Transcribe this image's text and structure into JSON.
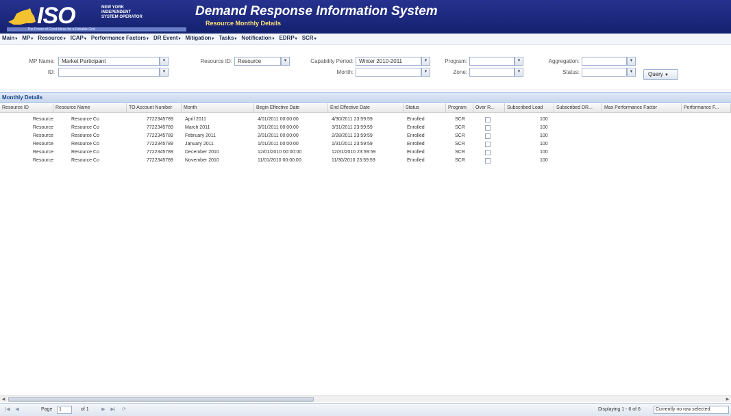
{
  "header": {
    "logo_text": "ISO",
    "logo_org": "NEW YORK INDEPENDENT SYSTEM OPERATOR",
    "logo_tagline": "The Power of Good Ideas for a Reliable Grid",
    "title": "Demand Response Information System",
    "subtitle": "Resource Monthly Details",
    "bar_color": "#1b2a7e",
    "subtitle_color": "#ffe27a"
  },
  "menu": [
    {
      "label": "Main",
      "icon": "chevron-down-icon"
    },
    {
      "label": "MP",
      "icon": "chevron-down-icon"
    },
    {
      "label": "Resource",
      "icon": "chevron-down-icon"
    },
    {
      "label": "ICAP",
      "icon": "chevron-down-icon"
    },
    {
      "label": "Performance Factors",
      "icon": "chevron-down-icon"
    },
    {
      "label": "DR Event",
      "icon": "chevron-down-icon"
    },
    {
      "label": "Mitigation",
      "icon": "chevron-down-icon"
    },
    {
      "label": "Tasks",
      "icon": "chevron-down-icon"
    },
    {
      "label": "Notification",
      "icon": "chevron-down-icon"
    },
    {
      "label": "EDRP",
      "icon": "chevron-down-icon"
    },
    {
      "label": "SCR",
      "icon": "chevron-down-icon"
    }
  ],
  "filters": {
    "mp_name": {
      "label": "MP Name:",
      "value": "Market Participant"
    },
    "id": {
      "label": "ID:",
      "value": ""
    },
    "resource_id": {
      "label": "Resource ID:",
      "value": "Resource"
    },
    "capability_period": {
      "label": "Capability Period:",
      "value": "Winter 2010-2011"
    },
    "month": {
      "label": "Month:",
      "value": ""
    },
    "program": {
      "label": "Program:",
      "value": ""
    },
    "zone": {
      "label": "Zone:",
      "value": ""
    },
    "aggregation": {
      "label": "Aggregation:",
      "value": ""
    },
    "status": {
      "label": "Status:",
      "value": ""
    },
    "query_label": "Query"
  },
  "grid": {
    "title": "Monthly Details",
    "columns": [
      "Resource ID",
      "Resource Name",
      "TO Account Number",
      "Month",
      "Begin Effective Date",
      "End Effective Date",
      "Status",
      "Program",
      "Over R...",
      "Subscribed Load",
      "Subscribed DR...",
      "Max Performance Factor",
      "Performance F..."
    ],
    "rows": [
      [
        "Resource",
        "Resource Co",
        "7722345789",
        "April 2011",
        "4/01/2011 00:00:00",
        "4/30/2011 23:59:59",
        "Enrolled",
        "SCR",
        false,
        "100"
      ],
      [
        "Resource",
        "Resource Co",
        "7722345789",
        "March 2011",
        "3/01/2011 00:00:00",
        "3/31/2011 23:59:59",
        "Enrolled",
        "SCR",
        false,
        "100"
      ],
      [
        "Resource",
        "Resource Co",
        "7722345789",
        "February 2011",
        "2/01/2011 00:00:00",
        "2/28/2011 23:59:59",
        "Enrolled",
        "SCR",
        false,
        "100"
      ],
      [
        "Resource",
        "Resource Co",
        "7722345789",
        "January 2011",
        "1/01/2011 00:00:00",
        "1/31/2011 23:59:59",
        "Enrolled",
        "SCR",
        false,
        "100"
      ],
      [
        "Resource",
        "Resource Co",
        "7722345789",
        "December 2010",
        "12/01/2010 00:00:00",
        "12/31/2010 23:59:59",
        "Enrolled",
        "SCR",
        false,
        "100"
      ],
      [
        "Resource",
        "Resource Co",
        "7722345789",
        "November 2010",
        "11/01/2010 00:00:00",
        "11/30/2010 23:59:59",
        "Enrolled",
        "SCR",
        false,
        "100"
      ]
    ]
  },
  "pager": {
    "page_label": "Page",
    "page_value": "1",
    "of_label": "of 1",
    "status": "Displaying 1 - 6 of 6",
    "select_value": "Currently no row selected"
  }
}
